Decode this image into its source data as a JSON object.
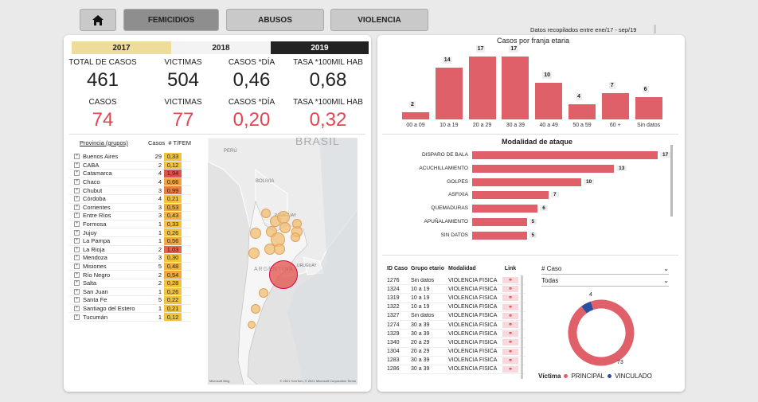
{
  "nav": {
    "home_icon": "home-icon",
    "buttons": [
      "FEMICIDIOS",
      "ABUSOS",
      "VIOLENCIA"
    ],
    "date_note": "Datos recopilados entre ene/17 - sep/19"
  },
  "years": [
    "2017",
    "2018",
    "2019"
  ],
  "kpis_top": [
    {
      "label": "TOTAL DE CASOS",
      "value": "461"
    },
    {
      "label": "VICTIMAS",
      "value": "504"
    },
    {
      "label": "CASOS *DÍA",
      "value": "0,46"
    },
    {
      "label": "TASA *100MIL HAB",
      "value": "0,68"
    }
  ],
  "kpis_bottom": [
    {
      "label": "CASOS",
      "value": "74"
    },
    {
      "label": "VICTIMAS",
      "value": "77"
    },
    {
      "label": "CASOS *DÍA",
      "value": "0,20"
    },
    {
      "label": "TASA *100MIL HAB",
      "value": "0,32"
    }
  ],
  "province_table": {
    "headers": [
      "Provincia (grupos)",
      "Casos",
      "# T/FEM"
    ],
    "rows": [
      {
        "name": "Buenos Aires",
        "casos": "29",
        "rate": "0,33",
        "color": "#f3c33c"
      },
      {
        "name": "CABA",
        "casos": "2",
        "rate": "0,12",
        "color": "#f3c33c"
      },
      {
        "name": "Catamarca",
        "casos": "4",
        "rate": "1,94",
        "color": "#e2504a"
      },
      {
        "name": "Chaco",
        "casos": "4",
        "rate": "0,66",
        "color": "#f0a13b"
      },
      {
        "name": "Chubut",
        "casos": "3",
        "rate": "0,99",
        "color": "#ea7d42"
      },
      {
        "name": "Córdoba",
        "casos": "4",
        "rate": "0,21",
        "color": "#f3c33c"
      },
      {
        "name": "Corrientes",
        "casos": "3",
        "rate": "0,53",
        "color": "#f0aa3a"
      },
      {
        "name": "Entre Ríos",
        "casos": "3",
        "rate": "0,43",
        "color": "#f1b43a"
      },
      {
        "name": "Formosa",
        "casos": "1",
        "rate": "0,33",
        "color": "#f3c33c"
      },
      {
        "name": "Jujuy",
        "casos": "1",
        "rate": "0,26",
        "color": "#f3c33c"
      },
      {
        "name": "La Pampa",
        "casos": "1",
        "rate": "0,56",
        "color": "#f0aa3a"
      },
      {
        "name": "La Rioja",
        "casos": "2",
        "rate": "1,03",
        "color": "#e5644a"
      },
      {
        "name": "Mendoza",
        "casos": "3",
        "rate": "0,30",
        "color": "#f3c33c"
      },
      {
        "name": "Misiones",
        "casos": "5",
        "rate": "0,48",
        "color": "#f1b43a"
      },
      {
        "name": "Río Negro",
        "casos": "2",
        "rate": "0,54",
        "color": "#f0aa3a"
      },
      {
        "name": "Salta",
        "casos": "2",
        "rate": "0,28",
        "color": "#f3c33c"
      },
      {
        "name": "San Juan",
        "casos": "1",
        "rate": "0,26",
        "color": "#f3c33c"
      },
      {
        "name": "Santa Fe",
        "casos": "5",
        "rate": "0,22",
        "color": "#f3c33c"
      },
      {
        "name": "Santiago del Estero",
        "casos": "1",
        "rate": "0,21",
        "color": "#f3c33c"
      },
      {
        "name": "Tucumán",
        "casos": "1",
        "rate": "0,12",
        "color": "#f3c33c"
      }
    ]
  },
  "map": {
    "labels": [
      "BRASIL",
      "PERÚ",
      "BOLIVIA",
      "ARGENTINA",
      "PARAGUAY",
      "URUGUAY"
    ],
    "footer_left": "Microsoft Bing",
    "footer_right": "© 2021 TomTom, © 2021 Microsoft Corporation  Terms"
  },
  "age_chart": {
    "title": "Casos por franja etaria",
    "categories": [
      "00 a 09",
      "10 a 19",
      "20 a 29",
      "30 a 39",
      "40 a 49",
      "50 a 59",
      "60 +",
      "Sin datos"
    ],
    "values": [
      2,
      14,
      17,
      17,
      10,
      4,
      7,
      6
    ]
  },
  "attack_chart": {
    "title": "Modalidad de ataque",
    "categories": [
      "DISPARO DE BALA",
      "ACUCHILLAMIENTO",
      "GOLPES",
      "ASFIXIA",
      "QUEMADURAS",
      "APUÑALAMIENTO",
      "SIN DATOS"
    ],
    "values": [
      17,
      13,
      10,
      7,
      6,
      5,
      5
    ]
  },
  "cases_table": {
    "headers": [
      "ID Caso",
      "Grupo etario",
      "Modalidad",
      "Link"
    ],
    "rows": [
      [
        "1276",
        "Sin datos",
        "VIOLENCIA FÍSICA"
      ],
      [
        "1324",
        "10 a 19",
        "VIOLENCIA FÍSICA"
      ],
      [
        "1319",
        "10 a 19",
        "VIOLENCIA FÍSICA"
      ],
      [
        "1322",
        "10 a 19",
        "VIOLENCIA FÍSICA"
      ],
      [
        "1327",
        "Sin datos",
        "VIOLENCIA FÍSICA"
      ],
      [
        "1274",
        "30 a 39",
        "VIOLENCIA FÍSICA"
      ],
      [
        "1329",
        "30 a 39",
        "VIOLENCIA FÍSICA"
      ],
      [
        "1340",
        "20 a 29",
        "VIOLENCIA FÍSICA"
      ],
      [
        "1304",
        "20 a 29",
        "VIOLENCIA FÍSICA"
      ],
      [
        "1283",
        "30 a 39",
        "VIOLENCIA FÍSICA"
      ],
      [
        "1286",
        "30 a 39",
        "VIOLENCIA FÍSICA"
      ]
    ],
    "link_icon": "link-icon"
  },
  "slicers": [
    {
      "label": "# Caso",
      "icon": "chevron-down-icon"
    },
    {
      "label": "Todas",
      "icon": "chevron-down-icon"
    }
  ],
  "donut": {
    "values": [
      73,
      4
    ],
    "labels": [
      "73",
      "4"
    ],
    "legend_title": "Víctima",
    "legend": [
      "PRINCIPAL",
      "VINCULADO"
    ],
    "colors": [
      "#e0606a",
      "#2b4ea0"
    ]
  },
  "colors": {
    "accent_red": "#e0464f",
    "bar": "#e0606a",
    "year_2017": "#eedd9a",
    "year_2019": "#222222"
  }
}
